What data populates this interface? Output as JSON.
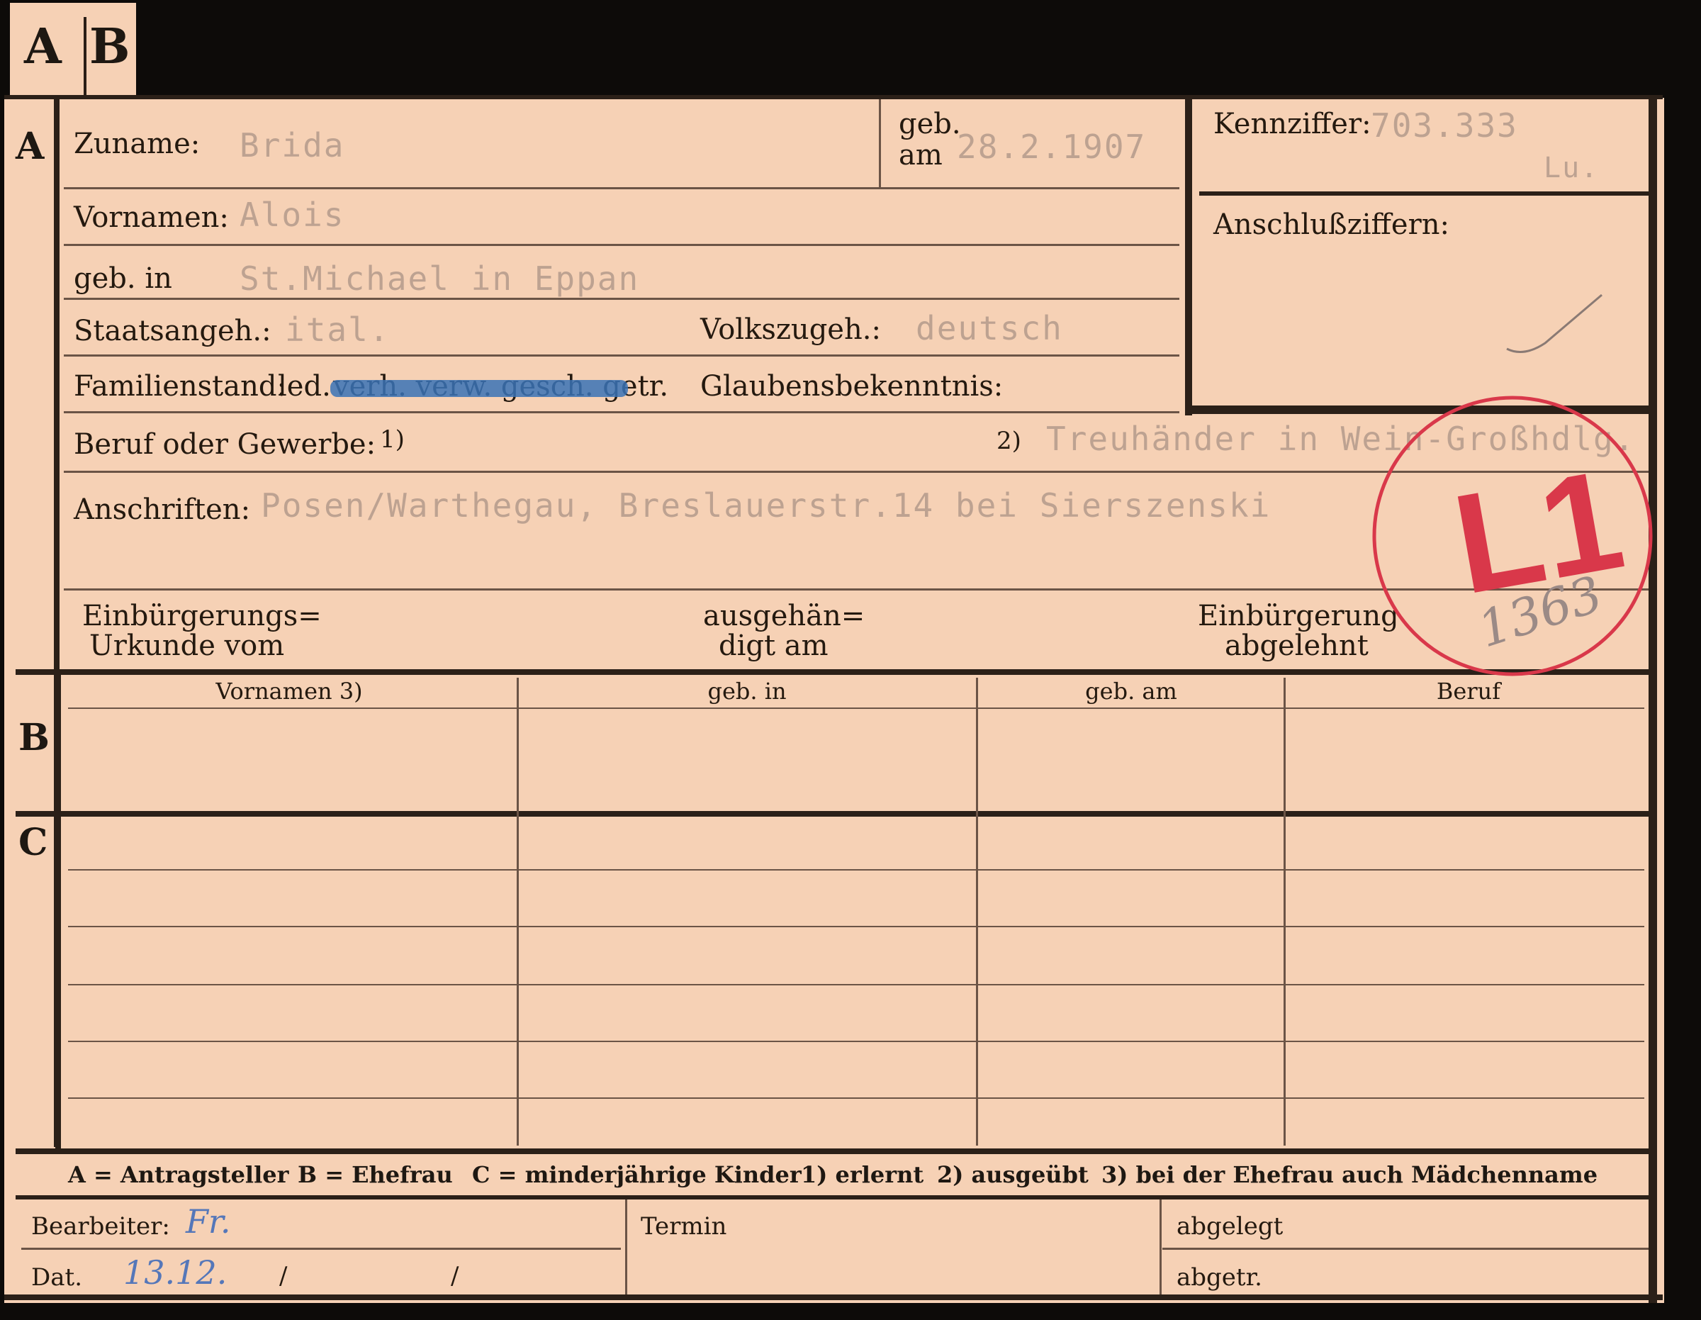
{
  "tabs": {
    "a": "A",
    "b": "B"
  },
  "section_a": {
    "marker": "A",
    "zuname_label": "Zuname:",
    "zuname_value": "Brida",
    "geb_am_label_1": "geb.",
    "geb_am_label_2": "am",
    "geb_am_value": "28.2.1907",
    "vornamen_label": "Vornamen:",
    "vornamen_value": "Alois",
    "geb_in_label": "geb. in",
    "geb_in_value": "St.Michael in Eppan",
    "staatsangeh_label": "Staatsangeh.:",
    "staatsangeh_value": "ital.",
    "volkszugeh_label": "Volkszugeh.:",
    "volkszugeh_value": "deutsch",
    "familienstand_label": "Familienstand:",
    "familienstand_led": "led.",
    "familienstand_struck": "verh. verw. gesch. getr.",
    "glaubensbekenntnis_label": "Glaubensbekenntnis:",
    "beruf_label": "Beruf oder Gewerbe:",
    "beruf_note1": "1)",
    "beruf_note2": "2)",
    "beruf_value": "Treuhänder in Wein-Großhdlg.",
    "anschriften_label": "Anschriften:",
    "anschriften_value": "Posen/Warthegau, Breslauerstr.14 bei Sierszenski",
    "einbuergerung_urkunde_1": "Einbürgerungs=",
    "einbuergerung_urkunde_2": "Urkunde vom",
    "ausgehaendigt_1": "ausgehän=",
    "ausgehaendigt_2": "digt am",
    "abgelehnt_1": "Einbürgerung",
    "abgelehnt_2": "abgelehnt"
  },
  "kennziffer": {
    "label": "Kennziffer:",
    "value": "703.333",
    "suffix": "Lu.",
    "anschluss_label": "Anschlußziffern:"
  },
  "stamp": {
    "text": "L1",
    "number": "1363",
    "color": "#d9384a"
  },
  "table": {
    "marker_b": "B",
    "marker_c": "C",
    "headers": [
      "Vornamen 3)",
      "geb. in",
      "geb. am",
      "Beruf"
    ]
  },
  "legend": {
    "a": "A = Antragsteller",
    "b": "B = Ehefrau",
    "c": "C = minderjährige Kinder",
    "n1": "1) erlernt",
    "n2": "2) ausgeübt",
    "n3": "3) bei der Ehefrau auch Mädchenname"
  },
  "footer": {
    "bearbeiter_label": "Bearbeiter:",
    "bearbeiter_value": "Fr.",
    "datum_label": "Dat.",
    "datum_value": "13.12.",
    "slash1": "/",
    "slash2": "/",
    "termin_label": "Termin",
    "abgelegt_label": "abgelegt",
    "abgetr_label": "abgetr."
  },
  "colors": {
    "card": "#f6d1b5",
    "ink": "#24190f",
    "typed": "#bda291",
    "strike": "#3a73b6",
    "pencil": "#5577b9"
  }
}
